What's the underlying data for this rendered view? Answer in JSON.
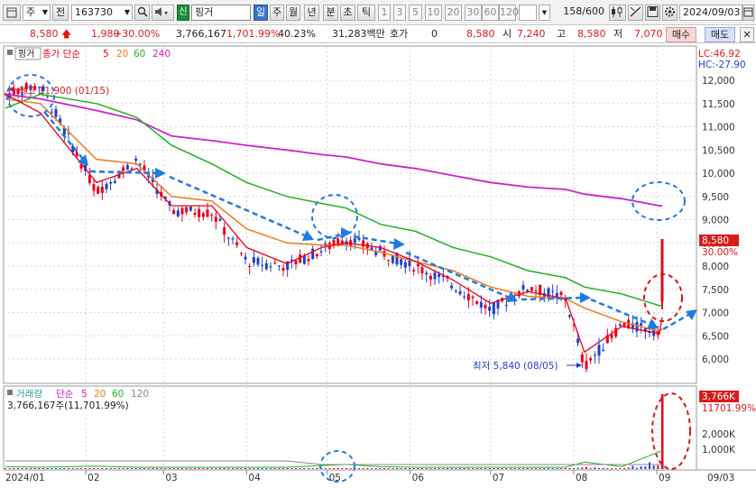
{
  "toolbar": {
    "market_selector": "주",
    "history_button": "전",
    "stock_code": "163730",
    "speaker_icon": "speaker-icon",
    "new_badge": "신",
    "stock_name": "핑거",
    "periods": [
      "일",
      "주",
      "월",
      "년",
      "분",
      "초",
      "틱"
    ],
    "active_period": "일",
    "intervals": [
      "1",
      "3",
      "5",
      "10",
      "20",
      "30",
      "60",
      "120"
    ],
    "count_value": "158",
    "count_total": "/600",
    "date": "2024/09/03"
  },
  "quote": {
    "price": "8,580",
    "change": "1,980",
    "change_pct": "+30.00%",
    "volume": "3,766,167",
    "volume_ratio": "1,701.99%",
    "turnover": "40.23%",
    "amount": "31,283백만",
    "hoga_label": "호가",
    "hoga_value": "0",
    "hoga_price": "8,580",
    "open_label": "시",
    "open": "7,240",
    "high_label": "고",
    "high": "8,580",
    "low_label": "저",
    "low": "7,070",
    "buy_button": "매수",
    "sell_button": "매도",
    "colors": {
      "up": "#d81c1c",
      "down": "#1f40c8",
      "buy_bg": "#f8d7d7",
      "sell_bg": "#d7e0f8"
    }
  },
  "price_panel": {
    "tag": "핑거",
    "legend_label": "종가 단순",
    "legend_periods": [
      "5",
      "20",
      "60",
      "240"
    ],
    "legend_colors": [
      "#e8001c",
      "#ee7a1a",
      "#22b022",
      "#cc22cc"
    ],
    "lc": "LC:46.92",
    "hc": "HC:-27.90",
    "y_ticks": [
      "12,000",
      "11,500",
      "11,000",
      "10,500",
      "10,000",
      "9,500",
      "9,000",
      "8,500",
      "8,000",
      "7,500",
      "7,000",
      "6,500",
      "6,000"
    ],
    "high_annotation": "최고 11,900 (01/15)",
    "low_annotation": "최저 5,840 (08/05)",
    "current_price_label": "8,580",
    "current_pct_label": "30.00%"
  },
  "volume_panel": {
    "label": "거래량",
    "legend_label": "단순",
    "legend_periods": [
      "5",
      "20",
      "60",
      "120"
    ],
    "legend_colors": [
      "#cc22cc",
      "#ee7a1a",
      "#22b022",
      "#888888"
    ],
    "value_text": "3,766,167주(11,701.99%)",
    "y_ticks": [
      "2,000K",
      "1,000K"
    ],
    "current_volume_label": "3,766K",
    "current_ratio_label": "11701.99%"
  },
  "x_axis": {
    "labels": [
      "2024/01",
      "02",
      "03",
      "04",
      "05",
      "06",
      "07",
      "08",
      "09",
      "09/03"
    ]
  },
  "chart_data": {
    "type": "line",
    "title": "",
    "xlabel": "",
    "ylabel": "",
    "ylim": [
      5700,
      12300
    ],
    "x": [
      "2024-01-02",
      "2024-01-15",
      "2024-02-05",
      "2024-02-20",
      "2024-03-04",
      "2024-03-19",
      "2024-04-01",
      "2024-04-16",
      "2024-04-29",
      "2024-05-08",
      "2024-05-21",
      "2024-06-03",
      "2024-06-17",
      "2024-07-01",
      "2024-07-15",
      "2024-07-29",
      "2024-08-05",
      "2024-08-19",
      "2024-09-02",
      "2024-09-03"
    ],
    "series": [
      {
        "name": "5",
        "values": [
          11700,
          11300,
          9800,
          10100,
          9300,
          9300,
          8400,
          8050,
          8400,
          8500,
          8400,
          8100,
          7700,
          7200,
          7450,
          7300,
          6150,
          6700,
          6550,
          6900
        ]
      },
      {
        "name": "20",
        "values": [
          11600,
          11500,
          10300,
          10200,
          9500,
          9400,
          8800,
          8500,
          8450,
          8450,
          8300,
          8100,
          7900,
          7550,
          7350,
          7300,
          7100,
          6800,
          6600,
          6650
        ]
      },
      {
        "name": "60",
        "values": [
          11400,
          11700,
          11500,
          11200,
          10600,
          10200,
          9800,
          9500,
          9350,
          9250,
          8900,
          8750,
          8400,
          8200,
          7900,
          7750,
          7550,
          7400,
          7150,
          7150
        ]
      },
      {
        "name": "240",
        "values": [
          11700,
          11600,
          11350,
          11150,
          10800,
          10700,
          10600,
          10500,
          10400,
          10350,
          10200,
          10100,
          9950,
          9800,
          9700,
          9650,
          9550,
          9450,
          9300,
          9300
        ]
      }
    ],
    "close_prices": [
      11700,
      11900,
      9600,
      10300,
      9200,
      9150,
      8100,
      8000,
      8350,
      8600,
      8300,
      8000,
      7600,
      7050,
      7550,
      7300,
      5840,
      6750,
      6600,
      8580
    ],
    "volume_k": [
      20,
      15,
      25,
      10,
      12,
      8,
      10,
      10,
      30,
      40,
      20,
      15,
      10,
      15,
      10,
      10,
      60,
      20,
      220,
      3766
    ],
    "grid": true
  }
}
